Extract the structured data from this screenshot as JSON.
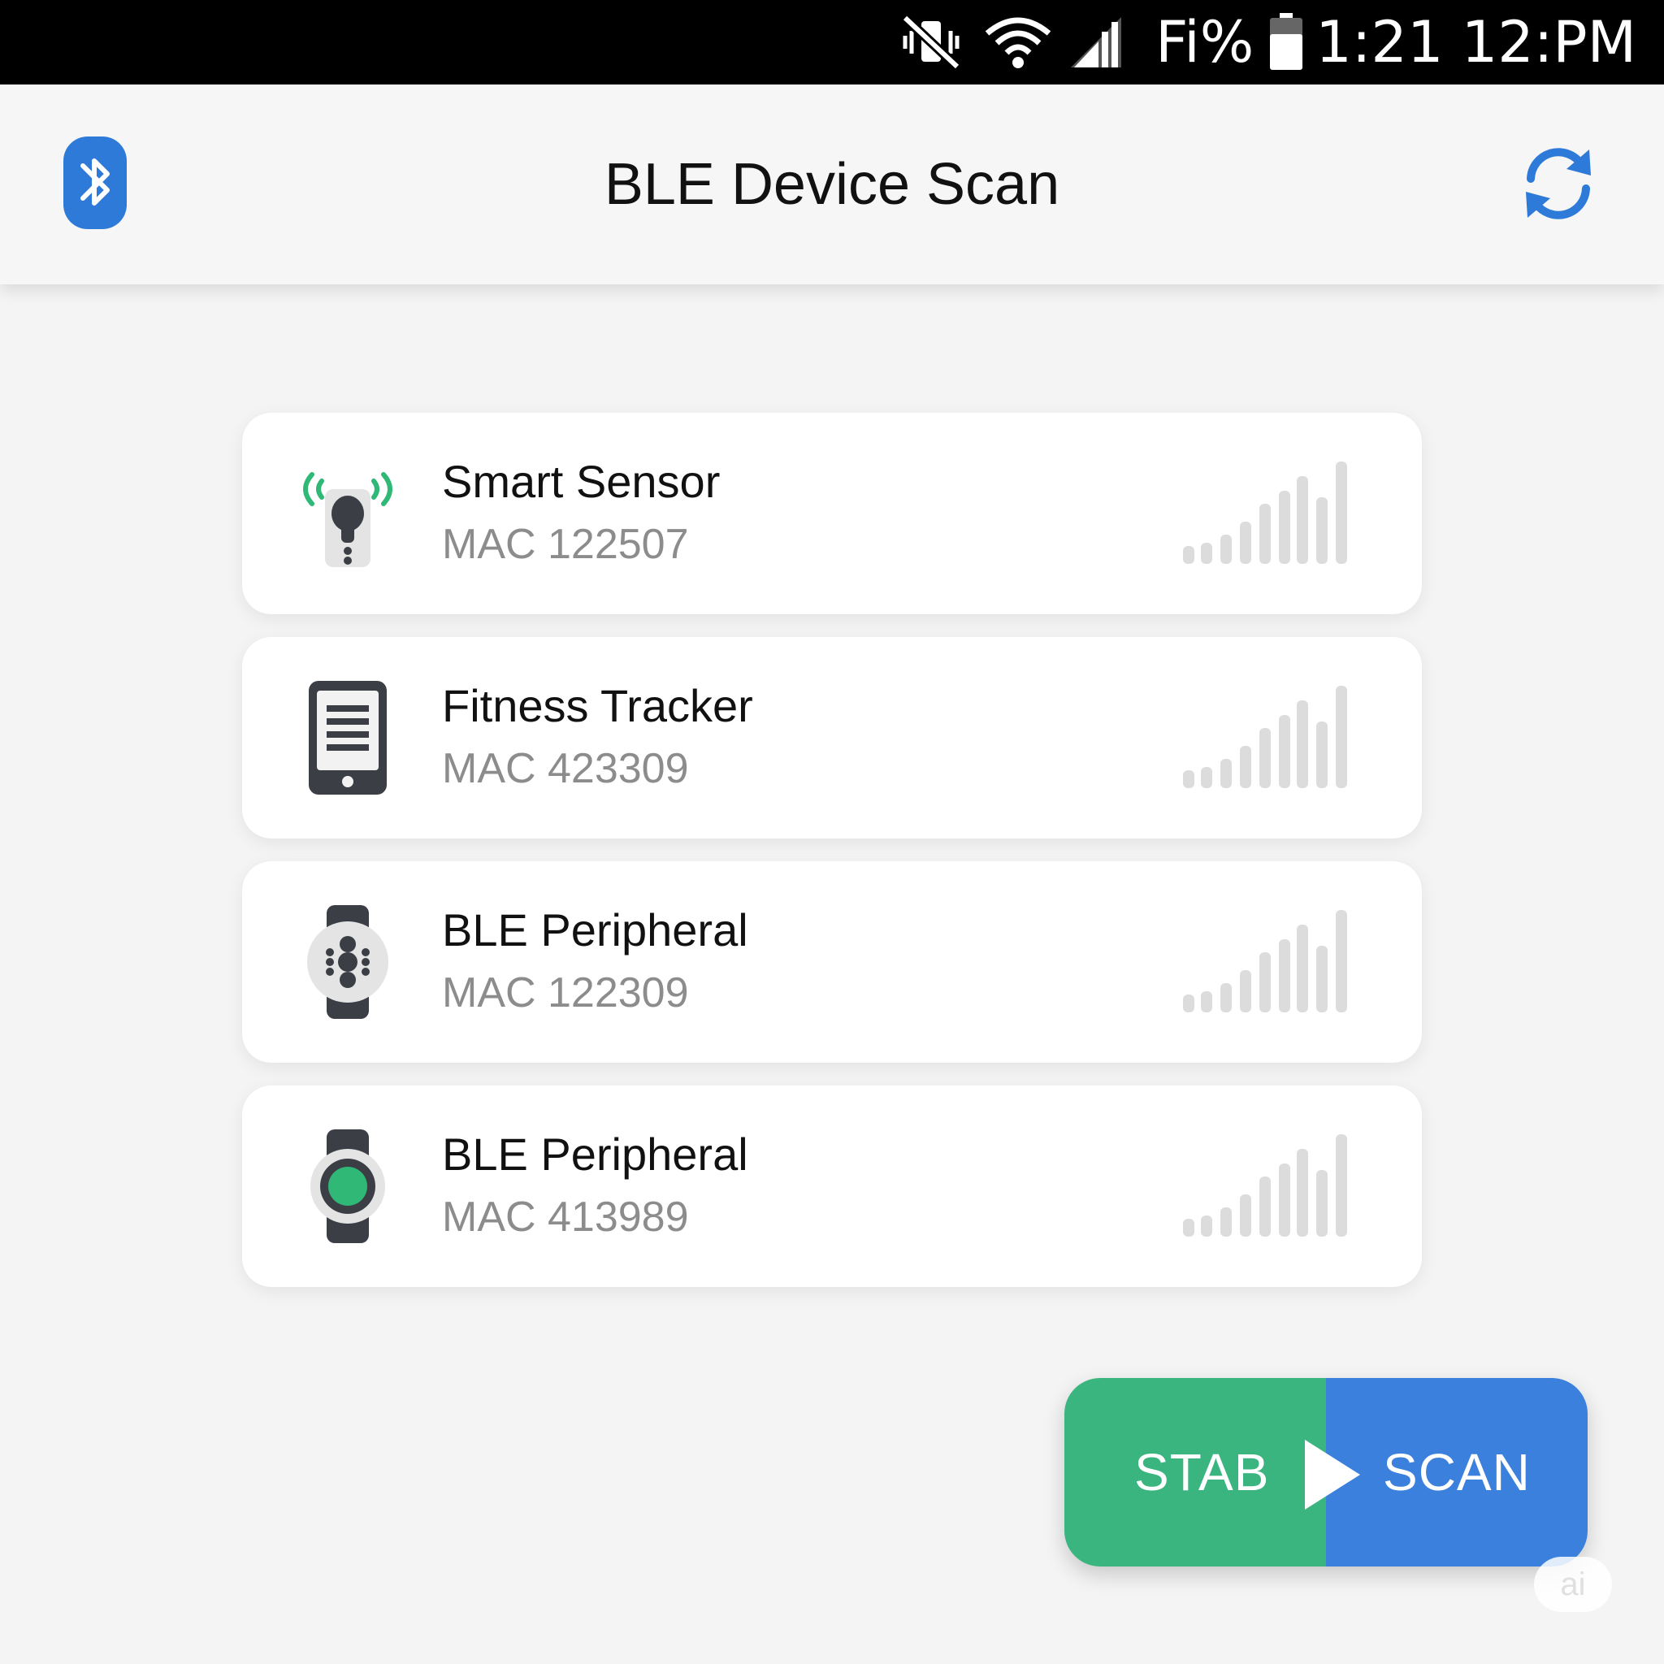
{
  "status_bar": {
    "carrier_text": "Fi%",
    "time_text": "1:21 12:PM",
    "icons": [
      "mute-vibrate-icon",
      "wifi-icon",
      "cell-signal-icon",
      "battery-icon"
    ]
  },
  "app_bar": {
    "title": "BLE Device Scan",
    "left_icon": "bluetooth-icon",
    "right_icon": "refresh-icon"
  },
  "devices": [
    {
      "name": "Smart Sensor",
      "mac": "MAC 122507",
      "icon": "smart-sensor-icon"
    },
    {
      "name": "Fitness Tracker",
      "mac": "MAC 423309",
      "icon": "fitness-tracker-icon"
    },
    {
      "name": "BLE Peripheral",
      "mac": "MAC 122309",
      "icon": "watch-dots-icon"
    },
    {
      "name": "BLE Peripheral",
      "mac": "MAC 413989",
      "icon": "watch-green-icon"
    }
  ],
  "scan_button": {
    "left_label": "STAB",
    "right_label": "SCAN",
    "left_color": "#3ab57f",
    "right_color": "#3a80dc"
  },
  "watermark": "ai",
  "colors": {
    "accent_blue": "#2e7ad8",
    "accent_green": "#2fb876",
    "signal_bar": "#dcdcdc"
  }
}
